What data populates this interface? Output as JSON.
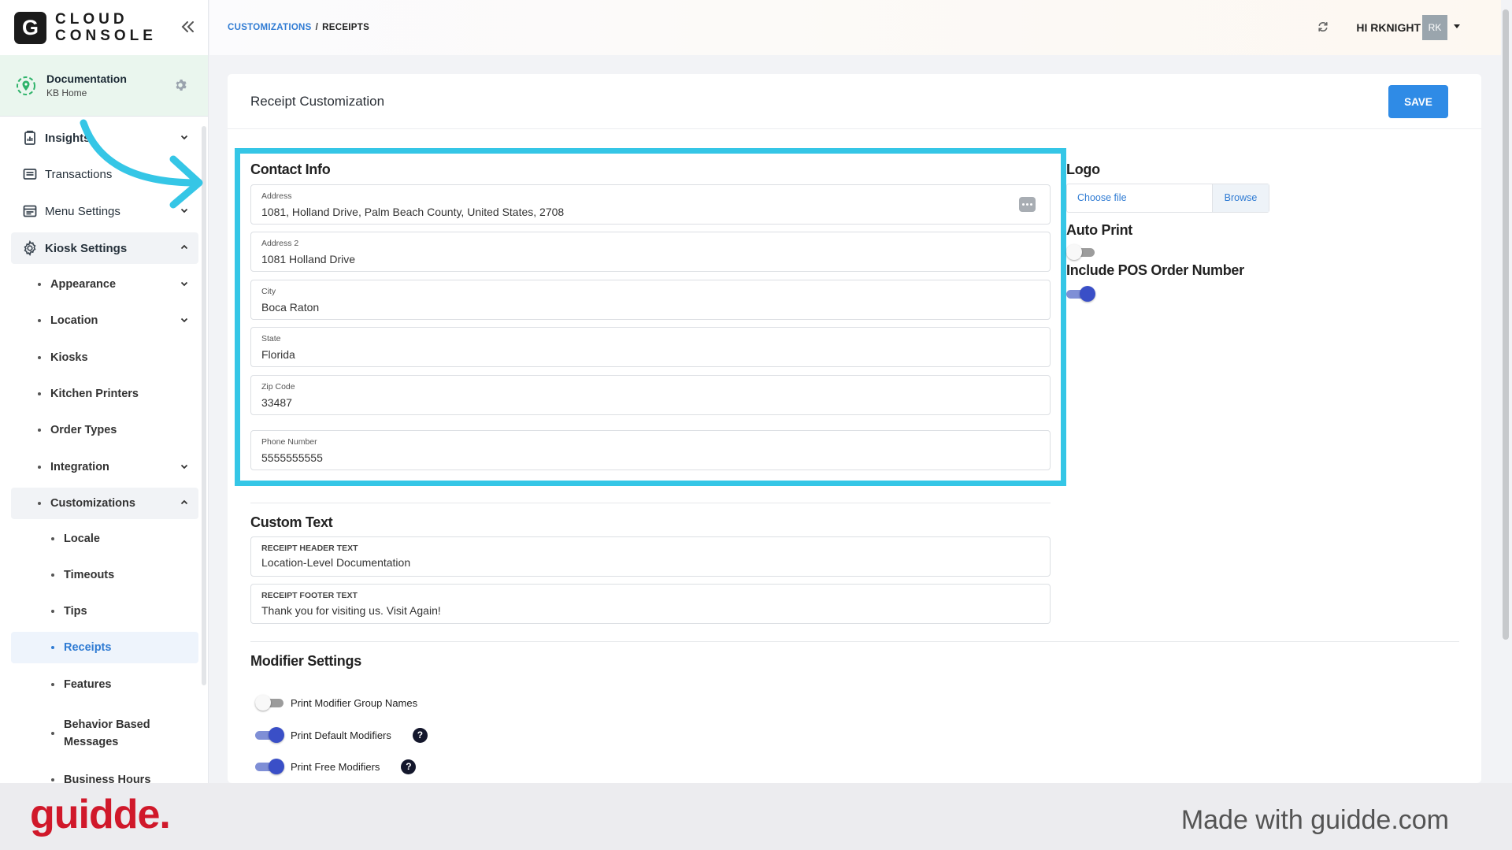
{
  "brand": {
    "logo_letter": "G",
    "line1": "CLOUD",
    "line2": "CONSOLE"
  },
  "store": {
    "name": "Documentation",
    "subtitle": "KB Home"
  },
  "sidebar": {
    "insights": "Insights",
    "transactions": "Transactions",
    "menu_settings": "Menu Settings",
    "kiosk_settings": "Kiosk Settings",
    "appearance": "Appearance",
    "location": "Location",
    "kiosks": "Kiosks",
    "kitchen_printers": "Kitchen Printers",
    "order_types": "Order Types",
    "integration": "Integration",
    "customizations": "Customizations",
    "locale": "Locale",
    "timeouts": "Timeouts",
    "tips": "Tips",
    "receipts": "Receipts",
    "features": "Features",
    "behavior_line1": "Behavior Based",
    "behavior_line2": "Messages",
    "business_hours": "Business Hours"
  },
  "breadcrumb": {
    "parent": "CUSTOMIZATIONS",
    "separator": "/",
    "current": "RECEIPTS"
  },
  "user": {
    "greeting": "HI RKNIGHT",
    "initials": "RK"
  },
  "page": {
    "title": "Receipt Customization",
    "save_label": "SAVE"
  },
  "contact": {
    "title": "Contact Info",
    "address_label": "Address",
    "address_value": "1081, Holland Drive, Palm Beach County, United States, 2708",
    "address2_label": "Address 2",
    "address2_value": "1081 Holland Drive",
    "city_label": "City",
    "city_value": "Boca Raton",
    "state_label": "State",
    "state_value": "Florida",
    "zip_label": "Zip Code",
    "zip_value": "33487",
    "phone_label": "Phone Number",
    "phone_value": "5555555555"
  },
  "right_panel": {
    "logo_title": "Logo",
    "choose_file": "Choose file",
    "browse": "Browse",
    "auto_print_title": "Auto Print",
    "auto_print_on": false,
    "pos_order_title": "Include POS Order Number",
    "pos_order_on": true
  },
  "custom_text": {
    "title": "Custom Text",
    "header_label": "RECEIPT HEADER TEXT",
    "header_value": "Location-Level Documentation",
    "footer_label": "RECEIPT FOOTER TEXT",
    "footer_value": "Thank you for visiting us. Visit Again!"
  },
  "modifier": {
    "title": "Modifier Settings",
    "group_names": "Print Modifier Group Names",
    "group_names_on": false,
    "default_mods": "Print Default Modifiers",
    "default_mods_on": true,
    "free_mods": "Print Free Modifiers",
    "free_mods_on": true,
    "help_glyph": "?"
  },
  "footer": {
    "logo": "guidde.",
    "made_with": "Made with guidde.com"
  },
  "colors": {
    "accent": "#2f8be6",
    "highlight": "#35c6e6",
    "toggle_on": "#3a4fc7",
    "guidde_red": "#d0182a"
  }
}
